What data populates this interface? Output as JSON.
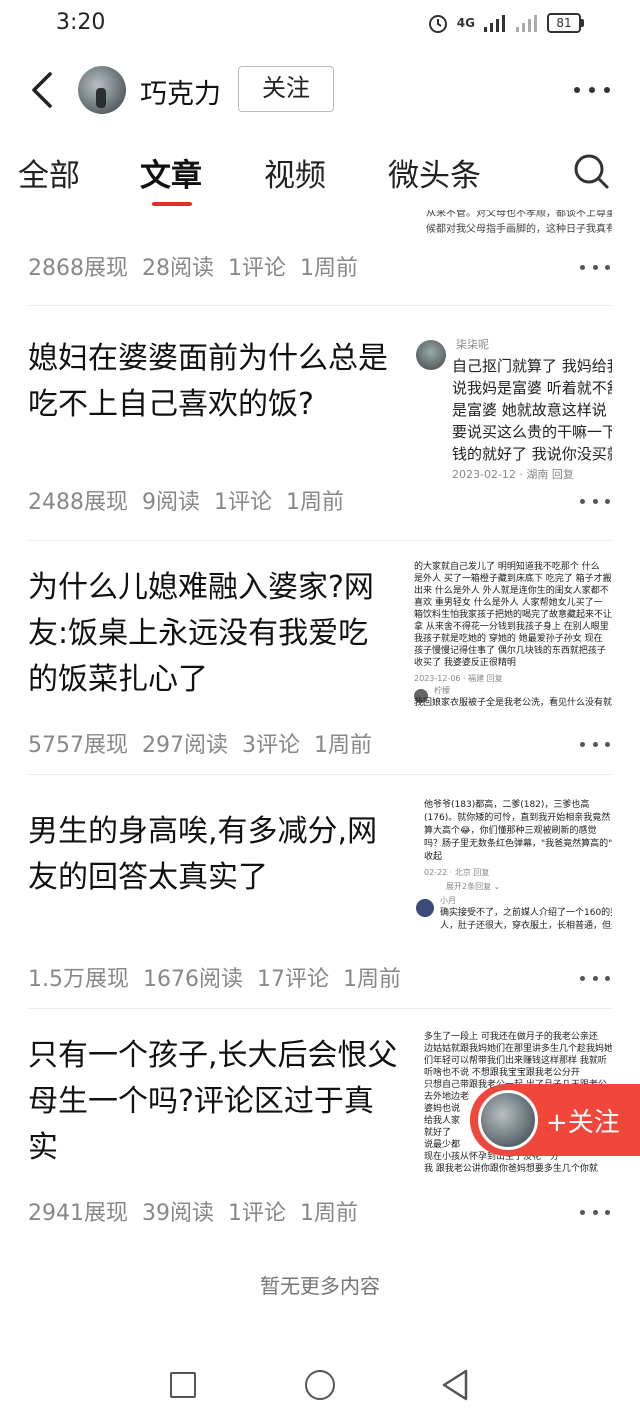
{
  "status_bar": {
    "time": "3:20",
    "network": "4G",
    "battery": "81"
  },
  "header": {
    "author_name": "巧克力",
    "follow_label": "关注"
  },
  "tabs": [
    {
      "label": "全部",
      "active": false
    },
    {
      "label": "文章",
      "active": true
    },
    {
      "label": "视频",
      "active": false
    },
    {
      "label": "微头条",
      "active": false
    }
  ],
  "articles": [
    {
      "title": "",
      "thumb_lines": [
        "从来不管。对父母也不孝顺，都谈不上尊重。有时",
        "候都对我父母指手画脚的，这种日子我真有点过不"
      ],
      "views": "2868展现",
      "reads": "28阅读",
      "comments": "1评论",
      "time": "1周前"
    },
    {
      "title": "媳妇在婆婆面前为什么总是吃不上自己喜欢的饭?",
      "thumb_user": "柒柒呢",
      "thumb_lines": [
        "自己抠门就算了 我妈给我儿",
        "说我妈是富婆  听着就不舒服",
        "是富婆  她就故意这样说  我给",
        "要说买这么贵的干嘛一下又要",
        "钱的就好了 我说你没买就给"
      ],
      "thumb_footer": "2023-02-12 · 湖南   回复",
      "views": "2488展现",
      "reads": "9阅读",
      "comments": "1评论",
      "time": "1周前"
    },
    {
      "title": "为什么儿媳难融入婆家?网友:饭桌上永远没有我爱吃的饭菜扎心了",
      "thumb_lines": [
        "的大家就自己发儿了 明明知道我不吃那个 什么",
        "是外人 买了一箱橙子藏到床底下 吃完了 箱子才搬",
        "出来  什么是外人 外人就是连你生的闺女人家都不",
        "喜欢  重男轻女  什么是外人 人家帮她女儿买了一",
        "箱饮料生怕我家孩子把她的喝完了故意藏起来不让",
        "拿 从来舍不得花一分钱到我孩子身上  在别人眼里",
        "我孩子就是吃她的 穿她的  她最爱孙子孙女 现在",
        "孩子慢慢记得住事了  偶尔几块钱的东西就把孩子",
        "收买了  我婆婆反正很精明"
      ],
      "thumb_footer": "2023-12-06 · 福建   回复",
      "thumb_user": "柠檬",
      "thumb_comment": "我回娘家衣服被子全是我老公洗，看见什么没有就",
      "views": "5757展现",
      "reads": "297阅读",
      "comments": "3评论",
      "time": "1周前"
    },
    {
      "title": "男生的身高唉,有多减分,网友的回答太真实了",
      "thumb_lines": [
        "他爷爷(183)都高，二爹(182)，三爹也高",
        "(176)。就你矮的可怜，直到我开始相亲我竟然",
        "算大高个😂，你们懂那种三观被刷新的感觉",
        "吗？肠子里无数条红色弹幕，\"我爸竟然算高的\"",
        "收起"
      ],
      "thumb_footer": "02-22 · 北京   回复",
      "thumb_expand": "展开2条回复 ⌄",
      "thumb_user": "小月",
      "thumb_comment": "确实接受不了，之前媒人介绍了一个160的男",
      "thumb_comment2": "人，肚子还很大，穿衣服土，长相普通，但是挺",
      "views": "1.5万展现",
      "reads": "1676阅读",
      "comments": "17评论",
      "time": "1周前"
    },
    {
      "title": "只有一个孩子,长大后会恨父母生一个吗?评论区过于真实",
      "thumb_lines": [
        "多生了一段上    可我还在做月子的我老公亲还",
        "边姑姑就跟我妈她们在那里讲多生几个趁我妈她",
        "们年轻可以帮带我们出来赚钱这样那样  我就听",
        "听啥也不说        不想跟我宝宝跟我老公分开",
        "只想自己带跟我老公一起    出了月子几天跟老公",
        "去外地边老",
        "婆妈也说",
        "给我人家",
        "就好了",
        "说最少都",
        "现在小孩从怀孕到出生了没花一分",
        "我  跟我老公讲你跟你爸妈想要多生几个你就"
      ],
      "views": "2941展现",
      "reads": "39阅读",
      "comments": "1评论",
      "time": "1周前"
    }
  ],
  "footer": {
    "no_more": "暂无更多内容"
  },
  "float_follow": {
    "label": "+关注"
  },
  "colors": {
    "accent": "#e0302a",
    "float_bg": "#f0463c",
    "meta_text": "#888888"
  },
  "icons": {
    "back": "back-arrow-icon",
    "more": "more-dots-icon",
    "search": "search-icon",
    "nav_recents": "square-icon",
    "nav_home": "circle-icon",
    "nav_back": "triangle-back-icon"
  }
}
